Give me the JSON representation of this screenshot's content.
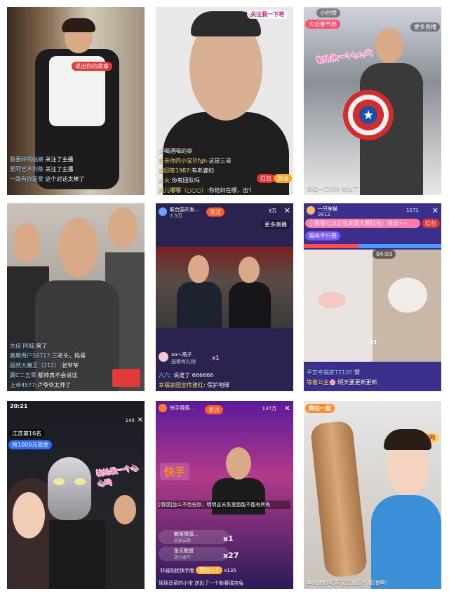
{
  "tiles": {
    "t1": {
      "mic_label": "说出你的故事",
      "comments": [
        {
          "user": "我要好的姑娘",
          "text": "关注了主播"
        },
        {
          "user": "爱阿艺不利茶",
          "text": "关注了主播"
        },
        {
          "user": "一路有你是爱",
          "text": "这个对话太棒了"
        }
      ]
    },
    "t2": {
      "top_banner": "关注我一下吧",
      "comments": [
        {
          "user": "",
          "text": "是喝酒喝的😄"
        },
        {
          "user": "亲亲你的小宝贝fgh:",
          "text": "这是三哥"
        },
        {
          "user": "请回答1987:",
          "text": "有老婆妇"
        },
        {
          "user": "火火:",
          "text": "你有团队吗"
        },
        {
          "user": "网儿嘟嘟（○○○）:",
          "text": "你给妇在哪，出个镜"
        }
      ],
      "red_packet": "红包",
      "add_wechat": "加油"
    },
    "t3": {
      "follow_tag": "小时榜",
      "header_title": "大话春节档",
      "more_live": "更多直播",
      "sticker": "能给我一个心心吗",
      "bottom_comment": "宣佳一口059 关注了"
    },
    "t4": {
      "comments": [
        {
          "user": "大佳 同城:",
          "text": "来了"
        },
        {
          "user": "鹿鹿用户58717:",
          "text": "三老头，捣蛋"
        },
        {
          "user": "固然大魔王（212）:",
          "text": "张爷爷"
        },
        {
          "user": "翼C二五零:",
          "text": "都帅真不会说话"
        },
        {
          "user": "上帝4577:",
          "text": "卢爷爷太帅了"
        }
      ]
    },
    "t5": {
      "host_name": "联合国开发...",
      "host_sub": "7.5万",
      "follow_btn": "关注",
      "viewers": "3万",
      "more_live": "更多直播",
      "gift_user": "aa～燕子",
      "gift_text": "送稀有礼物",
      "gift_count": "x1",
      "comments": [
        {
          "user": "六六:",
          "text": "说谁了 666666"
        },
        {
          "user": "幸福家园宣传建红:",
          "text": "保护地球"
        }
      ]
    },
    "t6": {
      "host_name": "一只笨猫",
      "host_sub": "9612",
      "viewers": "1171",
      "more_live": "更多直播",
      "banner": "小熊猫七点正在发超大颗红包！进去>>",
      "red_btn": "红包",
      "tag": "猫咪平行赛",
      "time": "04:03",
      "gift_count": "x1",
      "comments": [
        {
          "user": "平安幸福家72105:",
          "text": "赞"
        },
        {
          "user": "等着公主🌸:",
          "text": "明天要更新更新"
        }
      ]
    },
    "t7": {
      "status_time": "20:21",
      "viewers": "145",
      "rank": "江苏第16名",
      "promo": "抢1000元现金",
      "sticker": "能给我一个心心吗"
    },
    "t8": {
      "host_name": "快手情感...",
      "follow_btn": "关注",
      "viewers": "137万",
      "logo_text": "快手",
      "caption": "[情感]怎么不信任你，明明这关系里面能不能有所有",
      "gifts": [
        {
          "user": "敏姐情感...",
          "text": "送穿云箭",
          "count": "x1"
        },
        {
          "user": "鱼乐联盟",
          "text": "送小金牛",
          "count": "x27"
        }
      ],
      "gift_line": "非诚勿扰快手版",
      "gift_line_tag": "我也+1",
      "gift_line_count": "x135",
      "bottom_text": "瑶瑶音菜的小宝 送出了一个新春瑞吉兔"
    },
    "t9": {
      "badge": "倒在一起",
      "follow_btn": "关注我一下吧",
      "bottom_text": "本人太好吃车无法显示！加油啊！"
    }
  }
}
